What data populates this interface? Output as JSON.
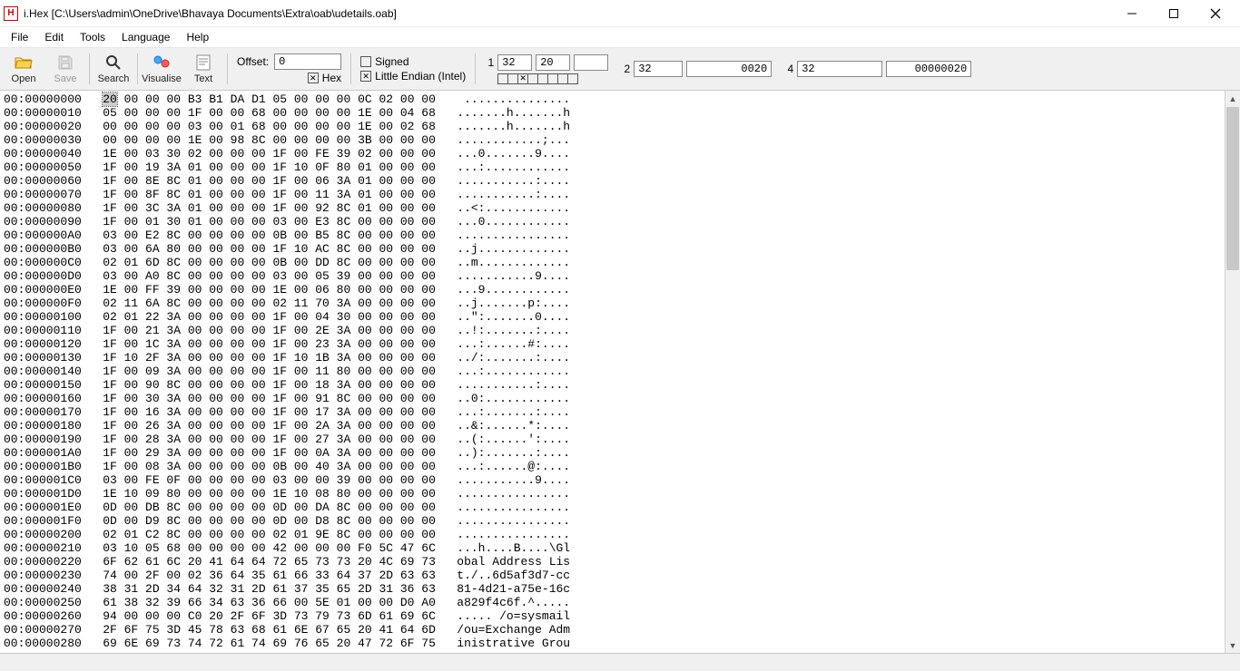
{
  "title": "i.Hex [C:\\Users\\admin\\OneDrive\\Bhavaya Documents\\Extra\\oab\\udetails.oab]",
  "menus": [
    "File",
    "Edit",
    "Tools",
    "Language",
    "Help"
  ],
  "toolbar": {
    "open": "Open",
    "save": "Save",
    "search": "Search",
    "visualise": "Visualise",
    "text": "Text"
  },
  "offset": {
    "label": "Offset:",
    "value": "0",
    "hex_label": "Hex",
    "hex_checked": true
  },
  "flags": {
    "signed_label": "Signed",
    "signed_checked": false,
    "endian_label": "Little Endian (Intel)",
    "endian_checked": true
  },
  "numeric": {
    "byte": {
      "label": "1",
      "dec": "32",
      "dec2": "20",
      "hex": ""
    },
    "word": {
      "label": "2",
      "dec": "32",
      "hex": "0020"
    },
    "dword": {
      "label": "4",
      "dec": "32",
      "hex": "00000020"
    },
    "bits": [
      false,
      false,
      true,
      false,
      false,
      false,
      false,
      false
    ]
  },
  "hex": {
    "addr_prefix": "00:",
    "rows": [
      {
        "addr": "00000000",
        "hex": "20 00 00 00 B3 B1 DA D1 05 00 00 00 0C 02 00 00",
        "ascii": " ..............."
      },
      {
        "addr": "00000010",
        "hex": "05 00 00 00 1F 00 00 68 00 00 00 00 1E 00 04 68",
        "ascii": ".......h.......h"
      },
      {
        "addr": "00000020",
        "hex": "00 00 00 00 03 00 01 68 00 00 00 00 1E 00 02 68",
        "ascii": ".......h.......h"
      },
      {
        "addr": "00000030",
        "hex": "00 00 00 00 1E 00 98 8C 00 00 00 00 3B 00 00 00",
        "ascii": "............;..."
      },
      {
        "addr": "00000040",
        "hex": "1E 00 03 30 02 00 00 00 1F 00 FE 39 02 00 00 00",
        "ascii": "...0.......9...."
      },
      {
        "addr": "00000050",
        "hex": "1F 00 19 3A 01 00 00 00 1F 10 0F 80 01 00 00 00",
        "ascii": "...:............"
      },
      {
        "addr": "00000060",
        "hex": "1F 00 8E 8C 01 00 00 00 1F 00 06 3A 01 00 00 00",
        "ascii": "...........:...."
      },
      {
        "addr": "00000070",
        "hex": "1F 00 8F 8C 01 00 00 00 1F 00 11 3A 01 00 00 00",
        "ascii": "...........:...."
      },
      {
        "addr": "00000080",
        "hex": "1F 00 3C 3A 01 00 00 00 1F 00 92 8C 01 00 00 00",
        "ascii": "..<:............"
      },
      {
        "addr": "00000090",
        "hex": "1F 00 01 30 01 00 00 00 03 00 E3 8C 00 00 00 00",
        "ascii": "...0............"
      },
      {
        "addr": "000000A0",
        "hex": "03 00 E2 8C 00 00 00 00 0B 00 B5 8C 00 00 00 00",
        "ascii": "................"
      },
      {
        "addr": "000000B0",
        "hex": "03 00 6A 80 00 00 00 00 1F 10 AC 8C 00 00 00 00",
        "ascii": "..j............."
      },
      {
        "addr": "000000C0",
        "hex": "02 01 6D 8C 00 00 00 00 0B 00 DD 8C 00 00 00 00",
        "ascii": "..m............."
      },
      {
        "addr": "000000D0",
        "hex": "03 00 A0 8C 00 00 00 00 03 00 05 39 00 00 00 00",
        "ascii": "...........9...."
      },
      {
        "addr": "000000E0",
        "hex": "1E 00 FF 39 00 00 00 00 1E 00 06 80 00 00 00 00",
        "ascii": "...9............"
      },
      {
        "addr": "000000F0",
        "hex": "02 11 6A 8C 00 00 00 00 02 11 70 3A 00 00 00 00",
        "ascii": "..j.......p:...."
      },
      {
        "addr": "00000100",
        "hex": "02 01 22 3A 00 00 00 00 1F 00 04 30 00 00 00 00",
        "ascii": "..\":.......0...."
      },
      {
        "addr": "00000110",
        "hex": "1F 00 21 3A 00 00 00 00 1F 00 2E 3A 00 00 00 00",
        "ascii": "..!:.......:...."
      },
      {
        "addr": "00000120",
        "hex": "1F 00 1C 3A 00 00 00 00 1F 00 23 3A 00 00 00 00",
        "ascii": "...:......#:...."
      },
      {
        "addr": "00000130",
        "hex": "1F 10 2F 3A 00 00 00 00 1F 10 1B 3A 00 00 00 00",
        "ascii": "../:.......:...."
      },
      {
        "addr": "00000140",
        "hex": "1F 00 09 3A 00 00 00 00 1F 00 11 80 00 00 00 00",
        "ascii": "...:............"
      },
      {
        "addr": "00000150",
        "hex": "1F 00 90 8C 00 00 00 00 1F 00 18 3A 00 00 00 00",
        "ascii": "...........:...."
      },
      {
        "addr": "00000160",
        "hex": "1F 00 30 3A 00 00 00 00 1F 00 91 8C 00 00 00 00",
        "ascii": "..0:............"
      },
      {
        "addr": "00000170",
        "hex": "1F 00 16 3A 00 00 00 00 1F 00 17 3A 00 00 00 00",
        "ascii": "...:.......:...."
      },
      {
        "addr": "00000180",
        "hex": "1F 00 26 3A 00 00 00 00 1F 00 2A 3A 00 00 00 00",
        "ascii": "..&:......*:...."
      },
      {
        "addr": "00000190",
        "hex": "1F 00 28 3A 00 00 00 00 1F 00 27 3A 00 00 00 00",
        "ascii": "..(:......':...."
      },
      {
        "addr": "000001A0",
        "hex": "1F 00 29 3A 00 00 00 00 1F 00 0A 3A 00 00 00 00",
        "ascii": "..):.......:...."
      },
      {
        "addr": "000001B0",
        "hex": "1F 00 08 3A 00 00 00 00 0B 00 40 3A 00 00 00 00",
        "ascii": "...:......@:...."
      },
      {
        "addr": "000001C0",
        "hex": "03 00 FE 0F 00 00 00 00 03 00 00 39 00 00 00 00",
        "ascii": "...........9...."
      },
      {
        "addr": "000001D0",
        "hex": "1E 10 09 80 00 00 00 00 1E 10 08 80 00 00 00 00",
        "ascii": "................"
      },
      {
        "addr": "000001E0",
        "hex": "0D 00 DB 8C 00 00 00 00 0D 00 DA 8C 00 00 00 00",
        "ascii": "................"
      },
      {
        "addr": "000001F0",
        "hex": "0D 00 D9 8C 00 00 00 00 0D 00 D8 8C 00 00 00 00",
        "ascii": "................"
      },
      {
        "addr": "00000200",
        "hex": "02 01 C2 8C 00 00 00 00 02 01 9E 8C 00 00 00 00",
        "ascii": "................"
      },
      {
        "addr": "00000210",
        "hex": "03 10 05 68 00 00 00 00 42 00 00 00 F0 5C 47 6C",
        "ascii": "...h....B....\\Gl"
      },
      {
        "addr": "00000220",
        "hex": "6F 62 61 6C 20 41 64 64 72 65 73 73 20 4C 69 73",
        "ascii": "obal Address Lis"
      },
      {
        "addr": "00000230",
        "hex": "74 00 2F 00 02 36 64 35 61 66 33 64 37 2D 63 63",
        "ascii": "t./..6d5af3d7-cc"
      },
      {
        "addr": "00000240",
        "hex": "38 31 2D 34 64 32 31 2D 61 37 35 65 2D 31 36 63",
        "ascii": "81-4d21-a75e-16c"
      },
      {
        "addr": "00000250",
        "hex": "61 38 32 39 66 34 63 36 66 00 5E 01 00 00 D0 A0",
        "ascii": "a829f4c6f.^....."
      },
      {
        "addr": "00000260",
        "hex": "94 00 00 00 C0 20 2F 6F 3D 73 79 73 6D 61 69 6C",
        "ascii": "..... /o=sysmail"
      },
      {
        "addr": "00000270",
        "hex": "2F 6F 75 3D 45 78 63 68 61 6E 67 65 20 41 64 6D",
        "ascii": "/ou=Exchange Adm"
      },
      {
        "addr": "00000280",
        "hex": "69 6E 69 73 74 72 61 74 69 76 65 20 47 72 6F 75",
        "ascii": "inistrative Grou"
      }
    ]
  }
}
